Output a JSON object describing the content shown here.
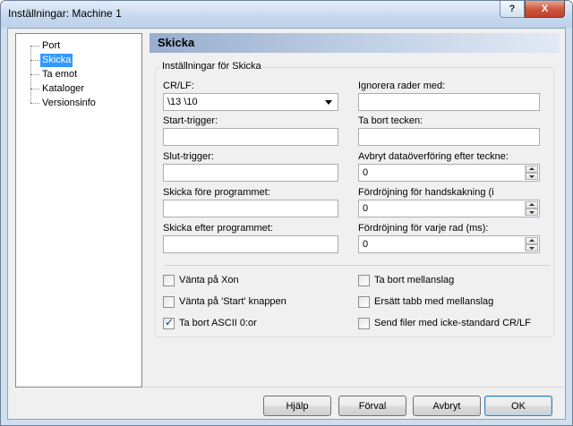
{
  "window": {
    "title": "Inställningar: Machine 1",
    "help_glyph": "?",
    "close_glyph": "X"
  },
  "tree": {
    "items": [
      {
        "label": "Port",
        "selected": false
      },
      {
        "label": "Skicka",
        "selected": true
      },
      {
        "label": "Ta emot",
        "selected": false
      },
      {
        "label": "Kataloger",
        "selected": false
      },
      {
        "label": "Versionsinfo",
        "selected": false
      }
    ]
  },
  "panel": {
    "title": "Skicka",
    "group_label": "Inställningar för Skicka",
    "left_fields": [
      {
        "label": "CR/LF:",
        "value": "\\13 \\10",
        "type": "combo"
      },
      {
        "label": "Start-trigger:",
        "value": "",
        "type": "text"
      },
      {
        "label": "Slut-trigger:",
        "value": "",
        "type": "text"
      },
      {
        "label": "Skicka före programmet:",
        "value": "",
        "type": "text"
      },
      {
        "label": "Skicka efter programmet:",
        "value": "",
        "type": "text"
      }
    ],
    "right_fields": [
      {
        "label": "Ignorera rader med:",
        "value": "",
        "type": "text"
      },
      {
        "label": "Ta bort tecken:",
        "value": "",
        "type": "text"
      },
      {
        "label": "Avbryt dataöverföring efter teckne:",
        "value": "0",
        "type": "spin"
      },
      {
        "label": "Fördröjning för handskakning  (i",
        "value": "0",
        "type": "spin"
      },
      {
        "label": "Fördröjning för varje rad (ms):",
        "value": "0",
        "type": "spin"
      }
    ],
    "checkboxes_left": [
      {
        "label": "Vänta på Xon",
        "checked": false
      },
      {
        "label": "Vänta på 'Start' knappen",
        "checked": false
      },
      {
        "label": "Ta bort ASCII 0:or",
        "checked": true
      }
    ],
    "checkboxes_right": [
      {
        "label": "Ta bort mellanslag",
        "checked": false
      },
      {
        "label": "Ersätt tabb med mellanslag",
        "checked": false
      },
      {
        "label": "Send filer med icke-standard CR/LF",
        "checked": false
      }
    ]
  },
  "buttons": {
    "help": "Hjälp",
    "default": "Förval",
    "cancel": "Avbryt",
    "ok": "OK"
  }
}
